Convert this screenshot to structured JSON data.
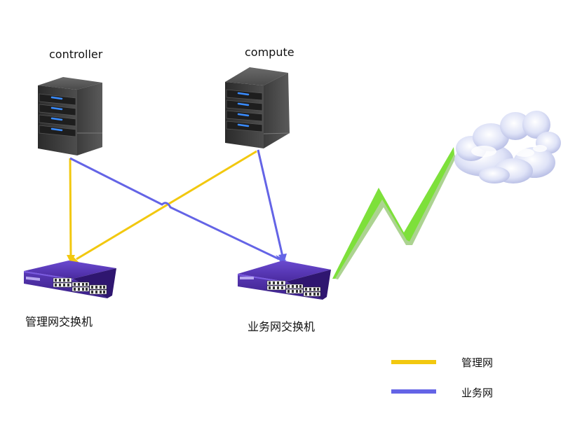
{
  "nodes": {
    "controller": {
      "label": "controller",
      "icon": "server-icon"
    },
    "compute": {
      "label": "compute",
      "icon": "server-icon"
    },
    "mgmt_switch": {
      "label": "管理网交换机",
      "icon": "network-switch-icon"
    },
    "biz_switch": {
      "label": "业务网交换机",
      "icon": "network-switch-icon"
    },
    "internet": {
      "icon": "cloud-icon"
    }
  },
  "links": [
    {
      "from": "controller",
      "to": "mgmt_switch",
      "network": "management"
    },
    {
      "from": "compute",
      "to": "mgmt_switch",
      "network": "management"
    },
    {
      "from": "controller",
      "to": "biz_switch",
      "network": "business"
    },
    {
      "from": "compute",
      "to": "biz_switch",
      "network": "business"
    },
    {
      "from": "biz_switch",
      "to": "internet",
      "network": "wireless",
      "icon": "lightning-link-icon"
    }
  ],
  "legend": [
    {
      "key": "management",
      "label": "管理网",
      "color": "#f2c80f"
    },
    {
      "key": "business",
      "label": "业务网",
      "color": "#6464e6"
    }
  ],
  "colors": {
    "management": "#f2c80f",
    "business": "#6464e6",
    "wireless": "#7de03a",
    "server_body": "#3a3a3a",
    "switch_body": "#4a2aa0"
  }
}
